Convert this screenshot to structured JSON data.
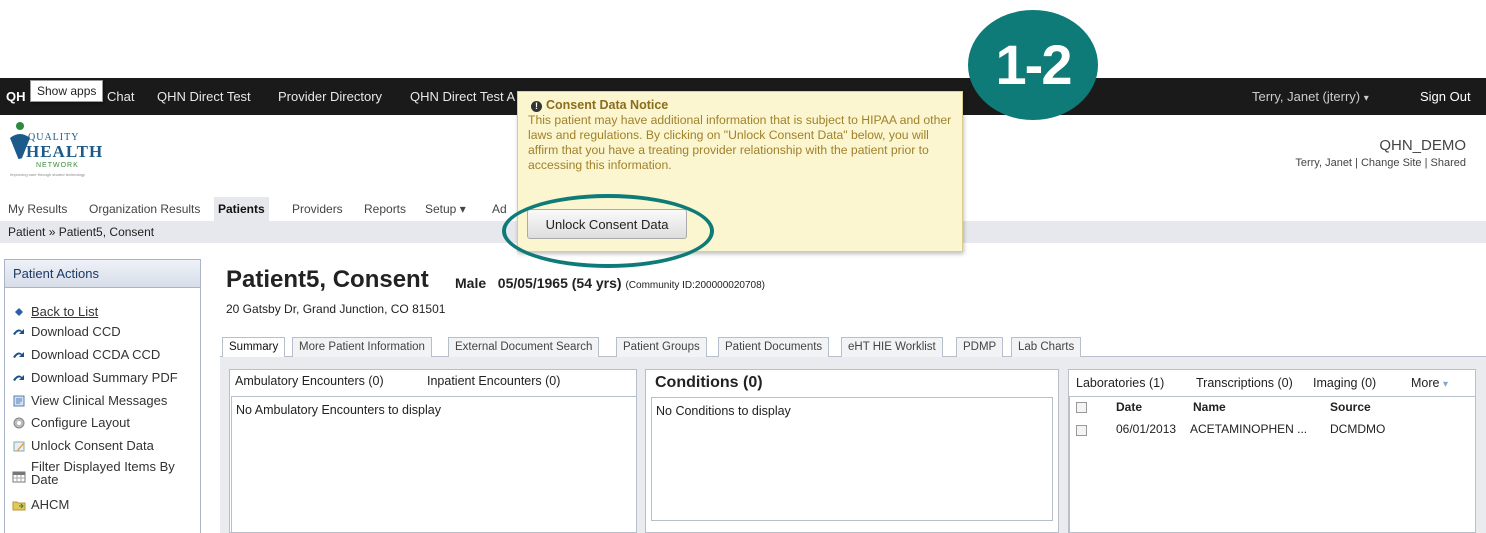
{
  "topbar": {
    "logo_fragment": "QH",
    "tooltip": "Show apps",
    "links": [
      "Chat",
      "QHN Direct Test",
      "Provider Directory",
      "QHN Direct Test A"
    ],
    "user": "Terry, Janet (jterry)",
    "user_caret": "▾",
    "sign_out": "Sign Out"
  },
  "logo": {
    "quality": "QUALITY",
    "health": "HEALTH",
    "network": "NETWORK",
    "tagline": "Improving care through shared technology"
  },
  "site": {
    "name": "QHN_DEMO",
    "user": "Terry, Janet",
    "sep1": "|",
    "change_site": "Change Site",
    "sep2": "|",
    "shared": "Shared"
  },
  "main_tabs": [
    "My Results",
    "Organization Results",
    "Patients",
    "Providers",
    "Reports",
    "Setup ▾",
    "Ad"
  ],
  "breadcrumb": "Patient » Patient5, Consent",
  "patient_actions": {
    "title": "Patient Actions",
    "items": [
      {
        "label": "Back to List",
        "icon": "diamond-icon"
      },
      {
        "label": "Download CCD",
        "icon": "arrow-icon"
      },
      {
        "label": "Download CCDA CCD",
        "icon": "arrow-icon"
      },
      {
        "label": "Download Summary PDF",
        "icon": "arrow-icon"
      },
      {
        "label": "View Clinical Messages",
        "icon": "messages-icon"
      },
      {
        "label": "Configure Layout",
        "icon": "gear-icon"
      },
      {
        "label": "Unlock Consent Data",
        "icon": "pencil-icon"
      },
      {
        "label": "Filter Displayed Items By",
        "label2": "Date",
        "icon": "calendar-icon"
      },
      {
        "label": "AHCM",
        "icon": "folder-icon"
      }
    ]
  },
  "patient": {
    "name": "Patient5, Consent",
    "sex": "Male",
    "dob": "05/05/1965 (54 yrs)",
    "community_id": "(Community ID:200000020708)",
    "address": "20 Gatsby Dr, Grand Junction, CO 81501"
  },
  "patient_tabs": [
    "Summary",
    "More Patient Information",
    "External Document Search",
    "Patient Groups",
    "Patient Documents",
    "eHT HIE Worklist",
    "PDMP",
    "Lab Charts"
  ],
  "encounters": {
    "tab1": "Ambulatory Encounters (0)",
    "tab2": "Inpatient Encounters (0)",
    "empty": "No Ambulatory Encounters to display"
  },
  "conditions": {
    "title": "Conditions (0)",
    "empty": "No Conditions to display"
  },
  "labs": {
    "tabs": [
      "Laboratories (1)",
      "Transcriptions (0)",
      "Imaging (0)",
      "More"
    ],
    "more_caret": "▾",
    "columns": [
      "Date",
      "Name",
      "Source"
    ],
    "rows": [
      {
        "date": "06/01/2013",
        "name": "ACETAMINOPHEN ...",
        "source": "DCMDMO"
      }
    ]
  },
  "notice": {
    "title": "Consent Data Notice",
    "body": "This patient may have additional information that is subject to HIPAA and other laws and regulations. By clicking on \"Unlock Consent Data\" below, you will affirm that you have a treating provider relationship with the patient prior to accessing this information.",
    "button": "Unlock Consent Data"
  },
  "step_badge": "1-2",
  "colors": {
    "topbar": "#1a1a1a",
    "badge": "#0e7b78",
    "notice_bg": "#fbf6cf",
    "notice_text": "#a0812c",
    "panel_bg": "#e9ebef"
  }
}
